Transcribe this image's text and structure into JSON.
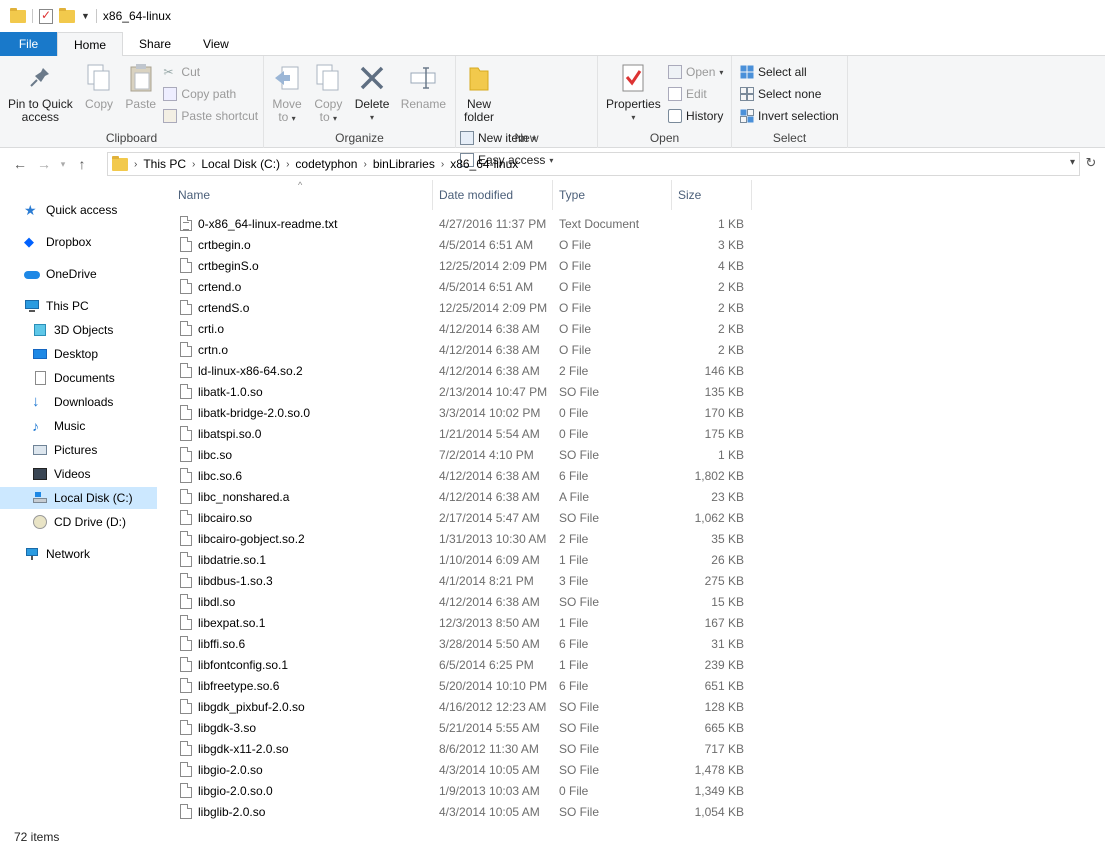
{
  "window": {
    "title": "x86_64-linux"
  },
  "tabs": [
    {
      "label": "File"
    },
    {
      "label": "Home"
    },
    {
      "label": "Share"
    },
    {
      "label": "View"
    }
  ],
  "ribbon": {
    "clipboard": {
      "label": "Clipboard",
      "pin": "Pin to Quick access",
      "pin_l1": "Pin to Quick",
      "pin_l2": "access",
      "copy": "Copy",
      "paste": "Paste",
      "cut": "Cut",
      "copy_path": "Copy path",
      "paste_shortcut": "Paste shortcut"
    },
    "organize": {
      "label": "Organize",
      "move_to_l1": "Move",
      "move_to_l2": "to",
      "copy_to_l1": "Copy",
      "copy_to_l2": "to",
      "delete": "Delete",
      "rename": "Rename"
    },
    "new": {
      "label": "New",
      "new_folder_l1": "New",
      "new_folder_l2": "folder",
      "new_item": "New item",
      "easy_access": "Easy access"
    },
    "open": {
      "label": "Open",
      "properties": "Properties",
      "open": "Open",
      "edit": "Edit",
      "history": "History"
    },
    "select": {
      "label": "Select",
      "select_all": "Select all",
      "select_none": "Select none",
      "invert": "Invert selection"
    }
  },
  "address": {
    "crumbs": [
      "This PC",
      "Local Disk (C:)",
      "codetyphon",
      "binLibraries",
      "x86_64-linux"
    ]
  },
  "sidebar": {
    "items": [
      {
        "label": "Quick access",
        "icon": "star-icon"
      },
      {
        "label": "Dropbox",
        "icon": "dropbox-icon"
      },
      {
        "label": "OneDrive",
        "icon": "cloud-icon"
      },
      {
        "label": "This PC",
        "icon": "computer-icon"
      },
      {
        "label": "3D Objects",
        "icon": "cube-icon"
      },
      {
        "label": "Desktop",
        "icon": "desktop-icon"
      },
      {
        "label": "Documents",
        "icon": "document-icon"
      },
      {
        "label": "Downloads",
        "icon": "download-icon"
      },
      {
        "label": "Music",
        "icon": "music-icon"
      },
      {
        "label": "Pictures",
        "icon": "picture-icon"
      },
      {
        "label": "Videos",
        "icon": "video-icon"
      },
      {
        "label": "Local Disk (C:)",
        "icon": "drive-icon"
      },
      {
        "label": "CD Drive (D:)",
        "icon": "cd-icon"
      },
      {
        "label": "Network",
        "icon": "network-icon"
      }
    ]
  },
  "columns": {
    "name": "Name",
    "date": "Date modified",
    "type": "Type",
    "size": "Size"
  },
  "files": [
    {
      "name": "0-x86_64-linux-readme.txt",
      "date": "4/27/2016 11:37 PM",
      "type": "Text Document",
      "size": "1 KB"
    },
    {
      "name": "crtbegin.o",
      "date": "4/5/2014 6:51 AM",
      "type": "O File",
      "size": "3 KB"
    },
    {
      "name": "crtbeginS.o",
      "date": "12/25/2014 2:09 PM",
      "type": "O File",
      "size": "4 KB"
    },
    {
      "name": "crtend.o",
      "date": "4/5/2014 6:51 AM",
      "type": "O File",
      "size": "2 KB"
    },
    {
      "name": "crtendS.o",
      "date": "12/25/2014 2:09 PM",
      "type": "O File",
      "size": "2 KB"
    },
    {
      "name": "crti.o",
      "date": "4/12/2014 6:38 AM",
      "type": "O File",
      "size": "2 KB"
    },
    {
      "name": "crtn.o",
      "date": "4/12/2014 6:38 AM",
      "type": "O File",
      "size": "2 KB"
    },
    {
      "name": "ld-linux-x86-64.so.2",
      "date": "4/12/2014 6:38 AM",
      "type": "2 File",
      "size": "146 KB"
    },
    {
      "name": "libatk-1.0.so",
      "date": "2/13/2014 10:47 PM",
      "type": "SO File",
      "size": "135 KB"
    },
    {
      "name": "libatk-bridge-2.0.so.0",
      "date": "3/3/2014 10:02 PM",
      "type": "0 File",
      "size": "170 KB"
    },
    {
      "name": "libatspi.so.0",
      "date": "1/21/2014 5:54 AM",
      "type": "0 File",
      "size": "175 KB"
    },
    {
      "name": "libc.so",
      "date": "7/2/2014 4:10 PM",
      "type": "SO File",
      "size": "1 KB"
    },
    {
      "name": "libc.so.6",
      "date": "4/12/2014 6:38 AM",
      "type": "6 File",
      "size": "1,802 KB"
    },
    {
      "name": "libc_nonshared.a",
      "date": "4/12/2014 6:38 AM",
      "type": "A File",
      "size": "23 KB"
    },
    {
      "name": "libcairo.so",
      "date": "2/17/2014 5:47 AM",
      "type": "SO File",
      "size": "1,062 KB"
    },
    {
      "name": "libcairo-gobject.so.2",
      "date": "1/31/2013 10:30 AM",
      "type": "2 File",
      "size": "35 KB"
    },
    {
      "name": "libdatrie.so.1",
      "date": "1/10/2014 6:09 AM",
      "type": "1 File",
      "size": "26 KB"
    },
    {
      "name": "libdbus-1.so.3",
      "date": "4/1/2014 8:21 PM",
      "type": "3 File",
      "size": "275 KB"
    },
    {
      "name": "libdl.so",
      "date": "4/12/2014 6:38 AM",
      "type": "SO File",
      "size": "15 KB"
    },
    {
      "name": "libexpat.so.1",
      "date": "12/3/2013 8:50 AM",
      "type": "1 File",
      "size": "167 KB"
    },
    {
      "name": "libffi.so.6",
      "date": "3/28/2014 5:50 AM",
      "type": "6 File",
      "size": "31 KB"
    },
    {
      "name": "libfontconfig.so.1",
      "date": "6/5/2014 6:25 PM",
      "type": "1 File",
      "size": "239 KB"
    },
    {
      "name": "libfreetype.so.6",
      "date": "5/20/2014 10:10 PM",
      "type": "6 File",
      "size": "651 KB"
    },
    {
      "name": "libgdk_pixbuf-2.0.so",
      "date": "4/16/2012 12:23 AM",
      "type": "SO File",
      "size": "128 KB"
    },
    {
      "name": "libgdk-3.so",
      "date": "5/21/2014 5:55 AM",
      "type": "SO File",
      "size": "665 KB"
    },
    {
      "name": "libgdk-x11-2.0.so",
      "date": "8/6/2012 11:30 AM",
      "type": "SO File",
      "size": "717 KB"
    },
    {
      "name": "libgio-2.0.so",
      "date": "4/3/2014 10:05 AM",
      "type": "SO File",
      "size": "1,478 KB"
    },
    {
      "name": "libgio-2.0.so.0",
      "date": "1/9/2013 10:03 AM",
      "type": "0 File",
      "size": "1,349 KB"
    },
    {
      "name": "libglib-2.0.so",
      "date": "4/3/2014 10:05 AM",
      "type": "SO File",
      "size": "1,054 KB"
    }
  ],
  "status": {
    "items": "72 items"
  }
}
